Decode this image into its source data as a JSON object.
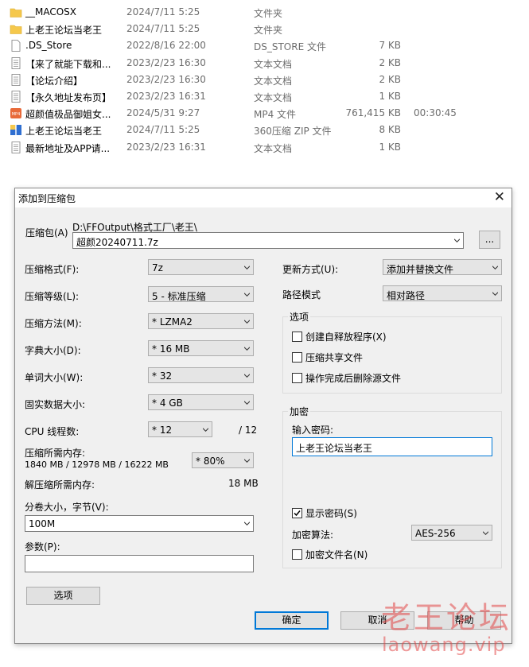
{
  "files": [
    {
      "name": "__MACOSX",
      "date": "2024/7/11 5:25",
      "type": "文件夹",
      "size": "",
      "duration": "",
      "icon": "folder-icon"
    },
    {
      "name": "上老王论坛当老王",
      "date": "2024/7/11 5:25",
      "type": "文件夹",
      "size": "",
      "duration": "",
      "icon": "folder-icon"
    },
    {
      "name": ".DS_Store",
      "date": "2022/8/16 22:00",
      "type": "DS_STORE 文件",
      "size": "7 KB",
      "duration": "",
      "icon": "file-icon"
    },
    {
      "name": "【来了就能下载和...",
      "date": "2023/2/23 16:30",
      "type": "文本文档",
      "size": "2 KB",
      "duration": "",
      "icon": "text-file-icon"
    },
    {
      "name": "【论坛介绍】",
      "date": "2023/2/23 16:30",
      "type": "文本文档",
      "size": "2 KB",
      "duration": "",
      "icon": "text-file-icon"
    },
    {
      "name": "【永久地址发布页】",
      "date": "2023/2/23 16:31",
      "type": "文本文档",
      "size": "1 KB",
      "duration": "",
      "icon": "text-file-icon"
    },
    {
      "name": "超颜值极品御姐女...",
      "date": "2024/5/31 9:27",
      "type": "MP4 文件",
      "size": "761,415 KB",
      "duration": "00:30:45",
      "icon": "video-file-icon"
    },
    {
      "name": "上老王论坛当老王",
      "date": "2024/7/11 5:25",
      "type": "360压缩 ZIP 文件",
      "size": "8 KB",
      "duration": "",
      "icon": "zip-file-icon"
    },
    {
      "name": "最新地址及APP请...",
      "date": "2023/2/23 16:31",
      "type": "文本文档",
      "size": "1 KB",
      "duration": "",
      "icon": "text-file-icon"
    }
  ],
  "dialog": {
    "title": "添加到压缩包",
    "archive_label": "压缩包(A)",
    "archive_path": "D:\\FFOutput\\格式工厂\\老王\\",
    "archive_name": "超颜20240711.7z",
    "browse_label": "...",
    "format_label": "压缩格式(F):",
    "format_value": "7z",
    "level_label": "压缩等级(L):",
    "level_value": "5 - 标准压缩",
    "method_label": "压缩方法(M):",
    "method_value": "* LZMA2",
    "dict_label": "字典大小(D):",
    "dict_value": "* 16 MB",
    "word_label": "单词大小(W):",
    "word_value": "* 32",
    "solid_label": "固实数据大小:",
    "solid_value": "* 4 GB",
    "cpu_label": "CPU 线程数:",
    "cpu_value": "* 12",
    "cpu_total": "/ 12",
    "mem_label": "压缩所需内存:",
    "mem_detail": "1840 MB / 12978 MB / 16222 MB",
    "mem_percent": "* 80%",
    "decomp_label": "解压缩所需内存:",
    "decomp_value": "18 MB",
    "split_label": "分卷大小，字节(V):",
    "split_value": "100M",
    "params_label": "参数(P):",
    "params_value": "",
    "options_button": "选项",
    "update_label": "更新方式(U):",
    "update_value": "添加并替换文件",
    "pathmode_label": "路径模式",
    "pathmode_value": "相对路径",
    "options_group": "选项",
    "opt_sfx": "创建自释放程序(X)",
    "opt_shared": "压缩共享文件",
    "opt_delete": "操作完成后删除源文件",
    "encrypt_group": "加密",
    "password_label": "输入密码:",
    "password_value": "上老王论坛当老王",
    "show_password": "显示密码(S)",
    "show_password_checked": true,
    "enc_method_label": "加密算法:",
    "enc_method_value": "AES-256",
    "encrypt_names": "加密文件名(N)",
    "ok": "确定",
    "cancel": "取消",
    "help": "帮助"
  },
  "watermark": {
    "line1": "老王论坛",
    "line2": "laowang.vip"
  },
  "colors": {
    "folder": "#f5c84c",
    "accent": "#0078d7",
    "watermark": "#e24747"
  }
}
